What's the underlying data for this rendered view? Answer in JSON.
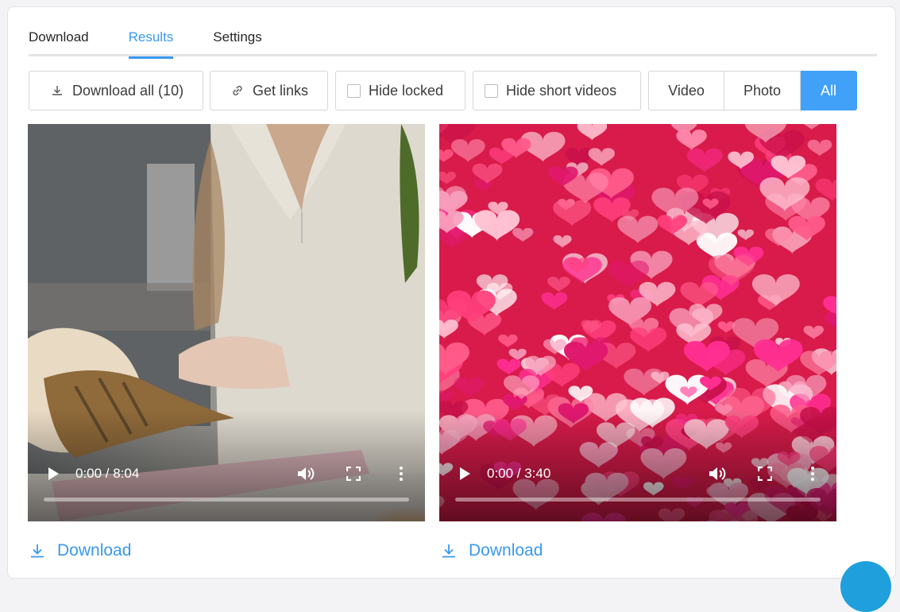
{
  "tabs": [
    {
      "label": "Download"
    },
    {
      "label": "Results",
      "active": true
    },
    {
      "label": "Settings"
    }
  ],
  "toolbar": {
    "download_all_label": "Download all (10)",
    "get_links_label": "Get links",
    "hide_locked_label": "Hide locked",
    "hide_locked_checked": false,
    "hide_short_label": "Hide short videos",
    "hide_short_checked": false,
    "filter": {
      "options": [
        "Video",
        "Photo",
        "All"
      ],
      "selected": "All"
    }
  },
  "videos": [
    {
      "time": "0:00 / 8:04",
      "download_label": "Download",
      "thumbnail": "woman-with-lobster-tail"
    },
    {
      "time": "0:00 / 3:40",
      "download_label": "Download",
      "thumbnail": "pink-hearts-background"
    }
  ],
  "colors": {
    "accent": "#3a98ef",
    "selected_segment": "#41a0f7",
    "border": "#d6d6da"
  },
  "icons": {
    "download": "download-icon",
    "link": "link-icon",
    "play": "play-icon",
    "volume": "volume-icon",
    "fullscreen": "fullscreen-icon",
    "more": "more-vertical-icon"
  }
}
